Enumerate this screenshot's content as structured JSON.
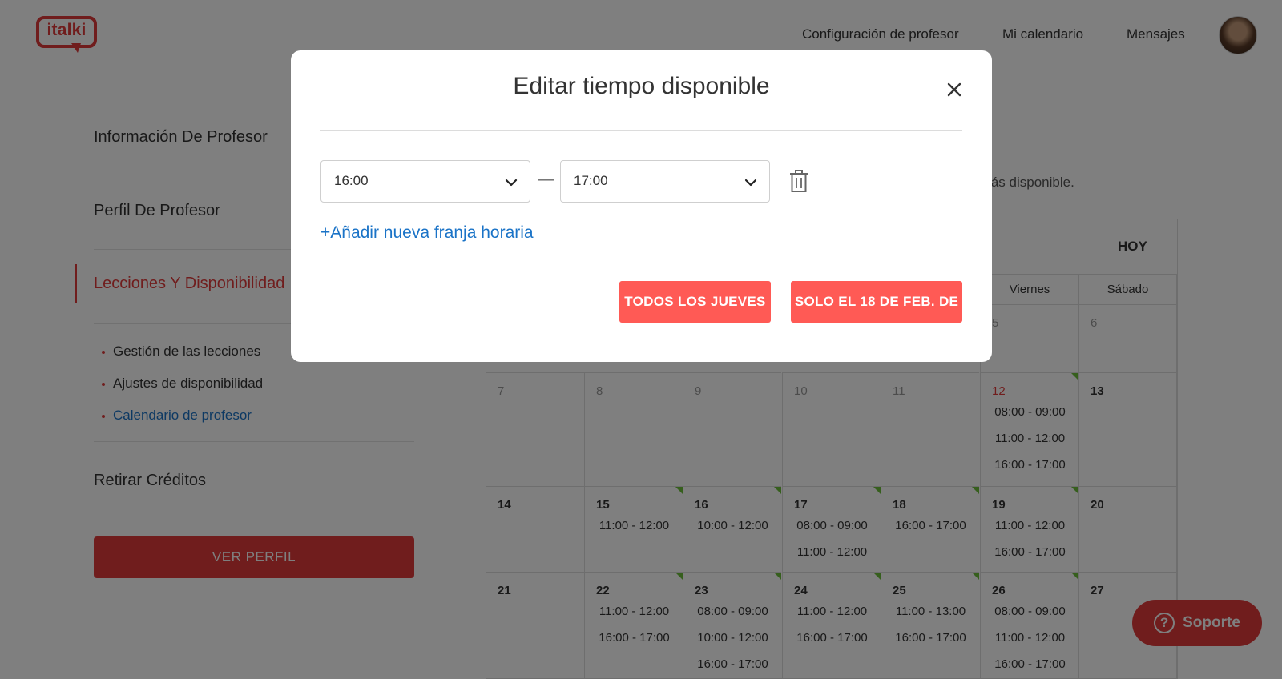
{
  "header": {
    "logo_text": "italki",
    "nav": [
      "Configuración de profesor",
      "Mi calendario",
      "Mensajes"
    ]
  },
  "sidebar": {
    "items": [
      "Información De Profesor",
      "Perfil De Profesor",
      "Lecciones Y Disponibilidad",
      "Retirar Créditos"
    ],
    "active_index": 2,
    "sub_items": [
      "Gestión de las lecciones",
      "Ajustes de disponibilidad",
      "Calendario de profesor"
    ],
    "active_sub_index": 2,
    "view_profile": "VER PERFIL"
  },
  "main": {
    "available_text": "e estás disponible.",
    "today_label": "HOY"
  },
  "calendar": {
    "visible_day_headers": [
      "Viernes",
      "Sábado"
    ],
    "partial_row": [
      {
        "num": "5",
        "muted": true
      },
      {
        "num": "6",
        "muted": true
      }
    ],
    "weeks": [
      [
        {
          "num": "7",
          "muted": true,
          "slots": []
        },
        {
          "num": "8",
          "muted": true,
          "slots": []
        },
        {
          "num": "9",
          "muted": true,
          "slots": []
        },
        {
          "num": "10",
          "muted": true,
          "slots": []
        },
        {
          "num": "11",
          "muted": true,
          "slots": []
        },
        {
          "num": "12",
          "today": true,
          "flag": true,
          "slots": [
            "08:00 - 09:00",
            "11:00 - 12:00",
            "16:00 - 17:00"
          ]
        },
        {
          "num": "13",
          "slots": []
        }
      ],
      [
        {
          "num": "14",
          "slots": []
        },
        {
          "num": "15",
          "flag": true,
          "slots": [
            "11:00 - 12:00"
          ]
        },
        {
          "num": "16",
          "flag": true,
          "slots": [
            "10:00 - 12:00"
          ]
        },
        {
          "num": "17",
          "flag": true,
          "slots": [
            "08:00 - 09:00",
            "11:00 - 12:00"
          ]
        },
        {
          "num": "18",
          "flag": true,
          "slots": [
            "16:00 - 17:00"
          ]
        },
        {
          "num": "19",
          "flag": true,
          "slots": [
            "11:00 - 12:00",
            "16:00 - 17:00"
          ]
        },
        {
          "num": "20",
          "slots": []
        }
      ],
      [
        {
          "num": "21",
          "slots": []
        },
        {
          "num": "22",
          "flag": true,
          "slots": [
            "11:00 - 12:00",
            "16:00 - 17:00"
          ]
        },
        {
          "num": "23",
          "flag": true,
          "slots": [
            "08:00 - 09:00",
            "10:00 - 12:00",
            "16:00 - 17:00"
          ]
        },
        {
          "num": "24",
          "flag": true,
          "slots": [
            "11:00 - 12:00",
            "16:00 - 17:00"
          ]
        },
        {
          "num": "25",
          "flag": true,
          "slots": [
            "11:00 - 13:00",
            "16:00 - 17:00"
          ]
        },
        {
          "num": "26",
          "flag": true,
          "slots": [
            "08:00 - 09:00",
            "11:00 - 12:00",
            "16:00 - 17:00"
          ]
        },
        {
          "num": "27",
          "slots": []
        }
      ]
    ],
    "flag_color": "#6cbf3a",
    "today_color": "#e03a3a"
  },
  "support": {
    "label": "Soporte",
    "icon": "question-circle-icon"
  },
  "modal": {
    "title": "Editar tiempo disponible",
    "start_time": "16:00",
    "end_time": "17:00",
    "separator": "—",
    "add_slot": "+Añadir nueva franja horaria",
    "btn_every": "TODOS LOS JUEVES",
    "btn_only": "SOLO EL 18 DE FEB. DE",
    "accent_color": "#ff5a55",
    "link_color": "#1a73c7"
  }
}
